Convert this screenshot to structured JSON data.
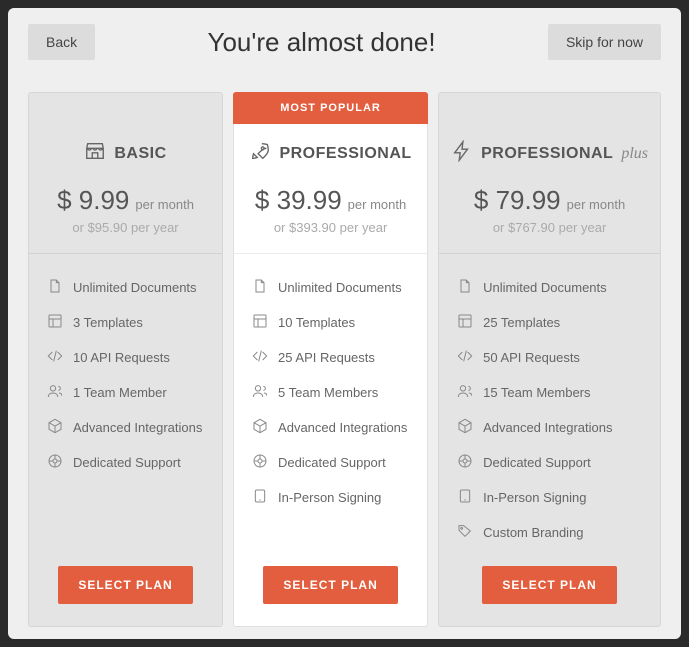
{
  "topbar": {
    "back": "Back",
    "title": "You're almost done!",
    "skip": "Skip for now"
  },
  "badge": "MOST POPULAR",
  "period_label": "per month",
  "cta_label": "SELECT PLAN",
  "plans": [
    {
      "name": "BASIC",
      "icon": "storefront-icon",
      "price": "$ 9.99",
      "yearly": "or $95.90 per year",
      "featured": false,
      "features": [
        {
          "icon": "document-icon",
          "label": "Unlimited Documents"
        },
        {
          "icon": "template-icon",
          "label": "3 Templates"
        },
        {
          "icon": "code-icon",
          "label": "10 API Requests"
        },
        {
          "icon": "team-icon",
          "label": "1 Team Member"
        },
        {
          "icon": "cube-icon",
          "label": "Advanced Integrations"
        },
        {
          "icon": "support-icon",
          "label": "Dedicated Support"
        }
      ]
    },
    {
      "name": "PROFESSIONAL",
      "icon": "rocket-icon",
      "price": "$ 39.99",
      "yearly": "or $393.90 per year",
      "featured": true,
      "features": [
        {
          "icon": "document-icon",
          "label": "Unlimited Documents"
        },
        {
          "icon": "template-icon",
          "label": "10 Templates"
        },
        {
          "icon": "code-icon",
          "label": "25 API Requests"
        },
        {
          "icon": "team-icon",
          "label": "5 Team Members"
        },
        {
          "icon": "cube-icon",
          "label": "Advanced Integrations"
        },
        {
          "icon": "support-icon",
          "label": "Dedicated Support"
        },
        {
          "icon": "tablet-icon",
          "label": "In-Person Signing"
        }
      ]
    },
    {
      "name": "PROFESSIONAL",
      "name_suffix": "plus",
      "icon": "lightning-icon",
      "price": "$ 79.99",
      "yearly": "or $767.90 per year",
      "featured": false,
      "features": [
        {
          "icon": "document-icon",
          "label": "Unlimited Documents"
        },
        {
          "icon": "template-icon",
          "label": "25 Templates"
        },
        {
          "icon": "code-icon",
          "label": "50 API Requests"
        },
        {
          "icon": "team-icon",
          "label": "15 Team Members"
        },
        {
          "icon": "cube-icon",
          "label": "Advanced Integrations"
        },
        {
          "icon": "support-icon",
          "label": "Dedicated Support"
        },
        {
          "icon": "tablet-icon",
          "label": "In-Person Signing"
        },
        {
          "icon": "tag-icon",
          "label": "Custom Branding"
        }
      ]
    }
  ]
}
